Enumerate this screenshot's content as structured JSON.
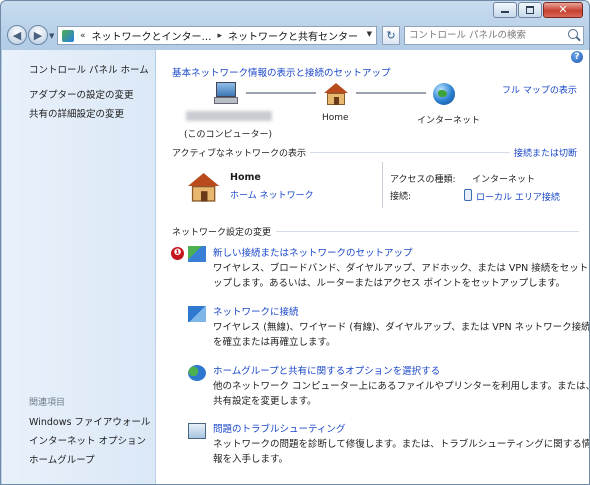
{
  "window": {
    "address": {
      "prefix": "«",
      "segment1": "ネットワークとインター…",
      "separator": "▸",
      "segment2": "ネットワークと共有センター"
    },
    "search_placeholder": "コントロール パネルの検索"
  },
  "sidebar": {
    "home": "コントロール パネル ホーム",
    "items": [
      "アダプターの設定の変更",
      "共有の詳細設定の変更"
    ],
    "related_label": "関連項目",
    "related": [
      "Windows ファイアウォール",
      "インターネット オプション",
      "ホームグループ"
    ]
  },
  "main": {
    "header_link": "基本ネットワーク情報の表示と接続のセットアップ",
    "full_map": "フル マップの表示",
    "map": {
      "computer_caption": "(このコンピューター)",
      "home": "Home",
      "internet": "インターネット"
    },
    "active_section": {
      "title": "アクティブなネットワークの表示",
      "connect_link": "接続または切断",
      "network_name": "Home",
      "network_type": "ホーム ネットワーク",
      "access_label": "アクセスの種類:",
      "access_value": "インターネット",
      "connection_label": "接続:",
      "connection_value": "ローカル エリア接続"
    },
    "change_section": {
      "title": "ネットワーク設定の変更",
      "badge": "❶",
      "items": [
        {
          "link": "新しい接続またはネットワークのセットアップ",
          "desc1": "ワイヤレス、ブロードバンド、ダイヤルアップ、アドホック、または VPN 接続をセットア",
          "desc2": "ップします。あるいは、ルーターまたはアクセス ポイントをセットアップします。"
        },
        {
          "link": "ネットワークに接続",
          "desc1": "ワイヤレス (無線)、ワイヤード (有線)、ダイヤルアップ、または VPN ネットワーク接続",
          "desc2": "を確立または再確立します。"
        },
        {
          "link": "ホームグループと共有に関するオプションを選択する",
          "desc1": "他のネットワーク コンピューター上にあるファイルやプリンターを利用します。または、",
          "desc2": "共有設定を変更します。"
        },
        {
          "link": "問題のトラブルシューティング",
          "desc1": "ネットワークの問題を診断して修復します。または、トラブルシューティングに関する情",
          "desc2": "報を入手します。"
        }
      ]
    }
  }
}
